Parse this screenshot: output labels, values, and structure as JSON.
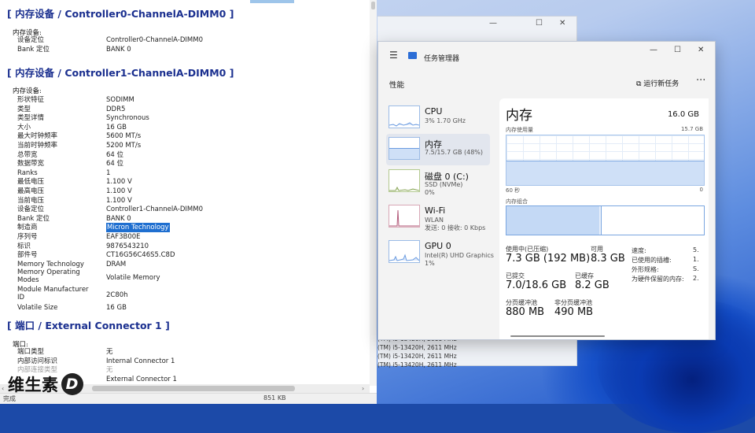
{
  "report": {
    "sections": [
      {
        "title": "[ 内存设备 / Controller0-ChannelA-DIMM0 ]"
      },
      {
        "title": "[ 内存设备 / Controller1-ChannelA-DIMM0 ]"
      },
      {
        "title": "[ 端口 / External Connector 1 ]"
      }
    ],
    "group1": "内存设备:",
    "group1_rows": [
      {
        "k": "设备定位",
        "v": "Controller0-ChannelA-DIMM0"
      },
      {
        "k": "Bank 定位",
        "v": "BANK 0"
      }
    ],
    "group2": "内存设备:",
    "group2_rows": [
      {
        "k": "形状特征",
        "v": "SODIMM"
      },
      {
        "k": "类型",
        "v": "DDR5"
      },
      {
        "k": "类型详情",
        "v": "Synchronous"
      },
      {
        "k": "大小",
        "v": "16 GB"
      },
      {
        "k": "最大时钟频率",
        "v": "5600 MT/s"
      },
      {
        "k": "当前时钟频率",
        "v": "5200 MT/s"
      },
      {
        "k": "总带宽",
        "v": "64 位"
      },
      {
        "k": "数据带宽",
        "v": "64 位"
      },
      {
        "k": "Ranks",
        "v": "1"
      },
      {
        "k": "最低电压",
        "v": "1.100 V"
      },
      {
        "k": "最高电压",
        "v": "1.100 V"
      },
      {
        "k": "当前电压",
        "v": "1.100 V"
      },
      {
        "k": "设备定位",
        "v": "Controller1-ChannelA-DIMM0"
      },
      {
        "k": "Bank 定位",
        "v": "BANK 0"
      },
      {
        "k": "制造商",
        "v": "Micron Technology"
      },
      {
        "k": "序列号",
        "v": "EAF3B00E"
      },
      {
        "k": "标识",
        "v": "9876543210"
      },
      {
        "k": "部件号",
        "v": "CT16G56C46S5.C8D"
      },
      {
        "k": "Memory Technology",
        "v": "DRAM"
      },
      {
        "k": "Memory Operating Modes",
        "v": "Volatile Memory"
      },
      {
        "k": "Module Manufacturer ID",
        "v": "2C80h"
      },
      {
        "k": "Volatile Size",
        "v": "16 GB"
      }
    ],
    "group3": "端口:",
    "group3_rows": [
      {
        "k": "端口类型",
        "v": "无"
      },
      {
        "k": "内部访问标识",
        "v": "Internal Connector 1"
      },
      {
        "k": "内部连接类型",
        "v": "无"
      },
      {
        "k": "",
        "v": "External Connector 1"
      }
    ],
    "status_left": "完成",
    "status_size": "851 KB",
    "logo_text": "维生素",
    "logo_badge": "D"
  },
  "backwin": {
    "cpu_lines": [
      "(TM) i5-13420H, 2611 MHz",
      "(TM) i5-13420H, 2611 MHz",
      "(TM) i5-13420H, 2611 MHz",
      "(TM) i5-13420H, 2611 MHz",
      "(TM) i5-13420H, 2611 MHz"
    ]
  },
  "taskmgr": {
    "title": "任务管理器",
    "page": "性能",
    "run_task": "运行新任务",
    "sidebar": [
      {
        "name": "CPU",
        "sub1": "3% 1.70 GHz",
        "sub2": ""
      },
      {
        "name": "内存",
        "sub1": "7.5/15.7 GB (48%)",
        "sub2": ""
      },
      {
        "name": "磁盘 0 (C:)",
        "sub1": "SSD (NVMe)",
        "sub2": "0%"
      },
      {
        "name": "Wi-Fi",
        "sub1": "WLAN",
        "sub2": "发送: 0 接收: 0 Kbps"
      },
      {
        "name": "GPU 0",
        "sub1": "Intel(R) UHD Graphics",
        "sub2": "1%"
      }
    ],
    "main": {
      "heading": "内存",
      "capacity": "16.0 GB",
      "usage_label": "内存使用量",
      "usage_max": "15.7 GB",
      "time_label": "60 秒",
      "time_end": "0",
      "comp_label": "内存组合",
      "usage_fraction": 0.48,
      "stats": [
        {
          "k": "使用中(已压缩)",
          "v": "7.3 GB (192 MB)"
        },
        {
          "k": "可用",
          "v": "8.3 GB"
        },
        {
          "k": "已提交",
          "v": "7.0/18.6 GB"
        },
        {
          "k": "已缓存",
          "v": "8.2 GB"
        },
        {
          "k": "分页缓冲池",
          "v": "880 MB"
        },
        {
          "k": "非分页缓冲池",
          "v": "490 MB"
        }
      ],
      "right_stats": [
        {
          "k": "速度:",
          "v": "5."
        },
        {
          "k": "已使用的插槽:",
          "v": "1."
        },
        {
          "k": "外形规格:",
          "v": "S."
        },
        {
          "k": "为硬件保留的内存:",
          "v": "2."
        }
      ]
    }
  },
  "colors": {
    "accent": "#1a2f8f",
    "graph_line": "#7aa6e0",
    "graph_fill": "#cfe0f7",
    "highlight": "#1f6fd0"
  }
}
